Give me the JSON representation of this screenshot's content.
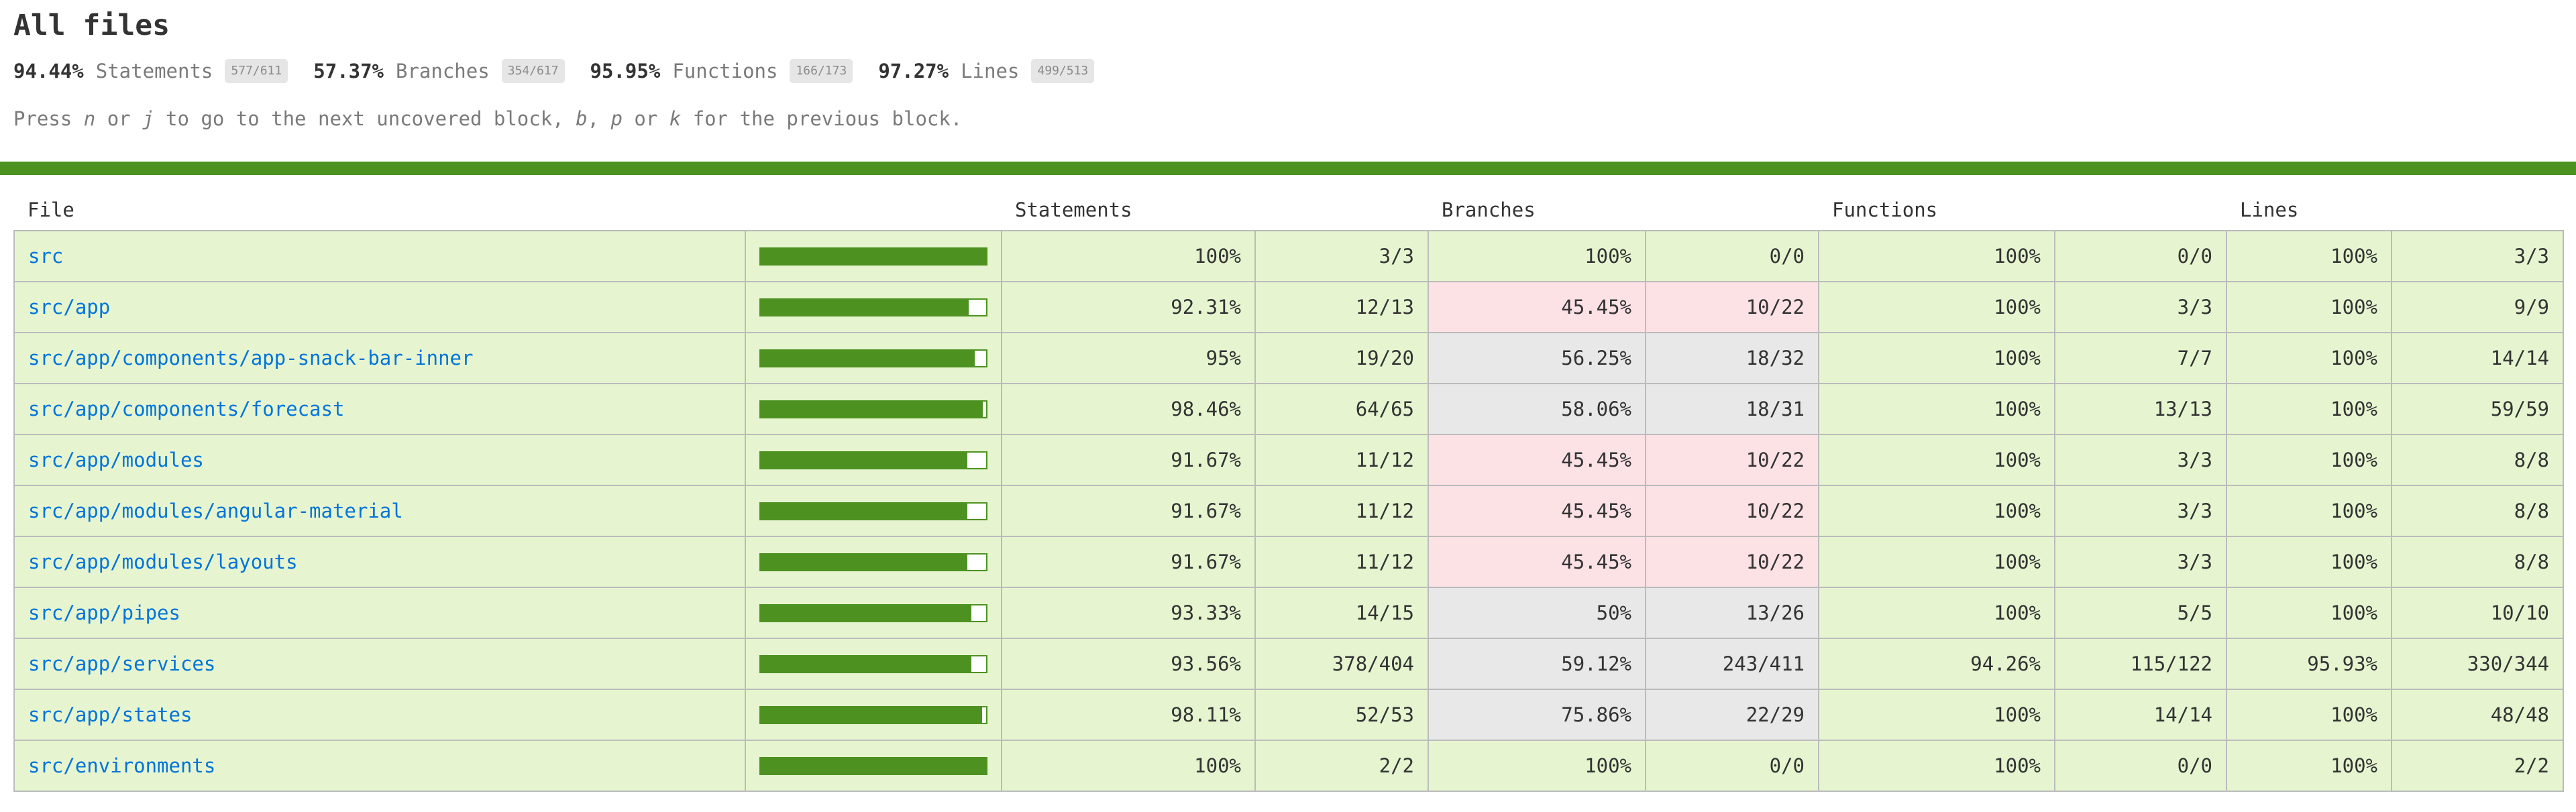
{
  "page": {
    "title": "All files"
  },
  "summary": [
    {
      "pct": "94.44%",
      "label": "Statements",
      "fraction": "577/611"
    },
    {
      "pct": "57.37%",
      "label": "Branches",
      "fraction": "354/617"
    },
    {
      "pct": "95.95%",
      "label": "Functions",
      "fraction": "166/173"
    },
    {
      "pct": "97.27%",
      "label": "Lines",
      "fraction": "499/513"
    }
  ],
  "hint": {
    "part1": "Press ",
    "key_n": "n",
    "part2": " or ",
    "key_j": "j",
    "part3": " to go to the next uncovered block, ",
    "key_b": "b",
    "part4": ", ",
    "key_p": "p",
    "part5": " or ",
    "key_k": "k",
    "part6": " for the previous block."
  },
  "colors": {
    "high": "#e6f5d0",
    "medium": "#e8e8e8",
    "low": "#fce1e5",
    "bar": "#4d9221",
    "link": "#0074d9"
  },
  "table": {
    "headers": {
      "file": "File",
      "statements": "Statements",
      "branches": "Branches",
      "functions": "Functions",
      "lines": "Lines"
    },
    "rows": [
      {
        "file": "src",
        "coverage": 1.0,
        "statements_pct": "100%",
        "statements": "3/3",
        "branches_pct": "100%",
        "branches": "0/0",
        "branches_level": "high",
        "functions_pct": "100%",
        "functions": "0/0",
        "lines_pct": "100%",
        "lines": "3/3"
      },
      {
        "file": "src/app",
        "coverage": 0.9231,
        "statements_pct": "92.31%",
        "statements": "12/13",
        "branches_pct": "45.45%",
        "branches": "10/22",
        "branches_level": "low",
        "functions_pct": "100%",
        "functions": "3/3",
        "lines_pct": "100%",
        "lines": "9/9"
      },
      {
        "file": "src/app/components/app-snack-bar-inner",
        "coverage": 0.95,
        "statements_pct": "95%",
        "statements": "19/20",
        "branches_pct": "56.25%",
        "branches": "18/32",
        "branches_level": "medium",
        "functions_pct": "100%",
        "functions": "7/7",
        "lines_pct": "100%",
        "lines": "14/14"
      },
      {
        "file": "src/app/components/forecast",
        "coverage": 0.9846,
        "statements_pct": "98.46%",
        "statements": "64/65",
        "branches_pct": "58.06%",
        "branches": "18/31",
        "branches_level": "medium",
        "functions_pct": "100%",
        "functions": "13/13",
        "lines_pct": "100%",
        "lines": "59/59"
      },
      {
        "file": "src/app/modules",
        "coverage": 0.9167,
        "statements_pct": "91.67%",
        "statements": "11/12",
        "branches_pct": "45.45%",
        "branches": "10/22",
        "branches_level": "low",
        "functions_pct": "100%",
        "functions": "3/3",
        "lines_pct": "100%",
        "lines": "8/8"
      },
      {
        "file": "src/app/modules/angular-material",
        "coverage": 0.9167,
        "statements_pct": "91.67%",
        "statements": "11/12",
        "branches_pct": "45.45%",
        "branches": "10/22",
        "branches_level": "low",
        "functions_pct": "100%",
        "functions": "3/3",
        "lines_pct": "100%",
        "lines": "8/8"
      },
      {
        "file": "src/app/modules/layouts",
        "coverage": 0.9167,
        "statements_pct": "91.67%",
        "statements": "11/12",
        "branches_pct": "45.45%",
        "branches": "10/22",
        "branches_level": "low",
        "functions_pct": "100%",
        "functions": "3/3",
        "lines_pct": "100%",
        "lines": "8/8"
      },
      {
        "file": "src/app/pipes",
        "coverage": 0.9333,
        "statements_pct": "93.33%",
        "statements": "14/15",
        "branches_pct": "50%",
        "branches": "13/26",
        "branches_level": "medium",
        "functions_pct": "100%",
        "functions": "5/5",
        "lines_pct": "100%",
        "lines": "10/10"
      },
      {
        "file": "src/app/services",
        "coverage": 0.9356,
        "statements_pct": "93.56%",
        "statements": "378/404",
        "branches_pct": "59.12%",
        "branches": "243/411",
        "branches_level": "medium",
        "functions_pct": "94.26%",
        "functions": "115/122",
        "lines_pct": "95.93%",
        "lines": "330/344"
      },
      {
        "file": "src/app/states",
        "coverage": 0.9811,
        "statements_pct": "98.11%",
        "statements": "52/53",
        "branches_pct": "75.86%",
        "branches": "22/29",
        "branches_level": "medium",
        "functions_pct": "100%",
        "functions": "14/14",
        "lines_pct": "100%",
        "lines": "48/48"
      },
      {
        "file": "src/environments",
        "coverage": 1.0,
        "statements_pct": "100%",
        "statements": "2/2",
        "branches_pct": "100%",
        "branches": "0/0",
        "branches_level": "high",
        "functions_pct": "100%",
        "functions": "0/0",
        "lines_pct": "100%",
        "lines": "2/2"
      }
    ]
  }
}
